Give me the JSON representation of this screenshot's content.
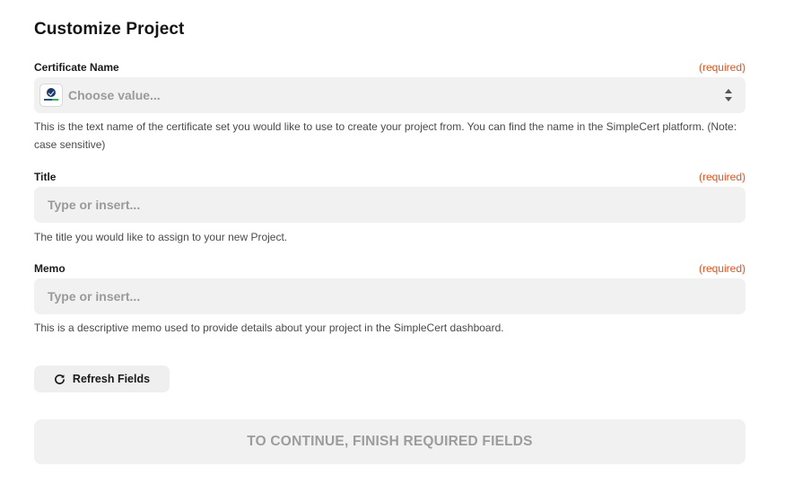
{
  "page": {
    "title": "Customize Project"
  },
  "fields": {
    "certificate_name": {
      "label": "Certificate Name",
      "required_tag": "(required)",
      "placeholder": "Choose value...",
      "help": "This is the text name of the certificate set you would like to use to create your project from. You can find the name in the SimpleCert platform. (Note: case sensitive)",
      "icon": "simplecert-app-icon"
    },
    "title": {
      "label": "Title",
      "required_tag": "(required)",
      "placeholder": "Type or insert...",
      "help": "The title you would like to assign to your new Project."
    },
    "memo": {
      "label": "Memo",
      "required_tag": "(required)",
      "placeholder": "Type or insert...",
      "help": "This is a descriptive memo used to provide details about your project in the SimpleCert dashboard."
    }
  },
  "actions": {
    "refresh_label": "Refresh Fields",
    "refresh_icon": "refresh-icon",
    "continue_label": "TO CONTINUE, FINISH REQUIRED FIELDS"
  },
  "colors": {
    "required": "#e0541d",
    "input_bg": "#f1f1f1",
    "placeholder": "#9a9a9a"
  }
}
